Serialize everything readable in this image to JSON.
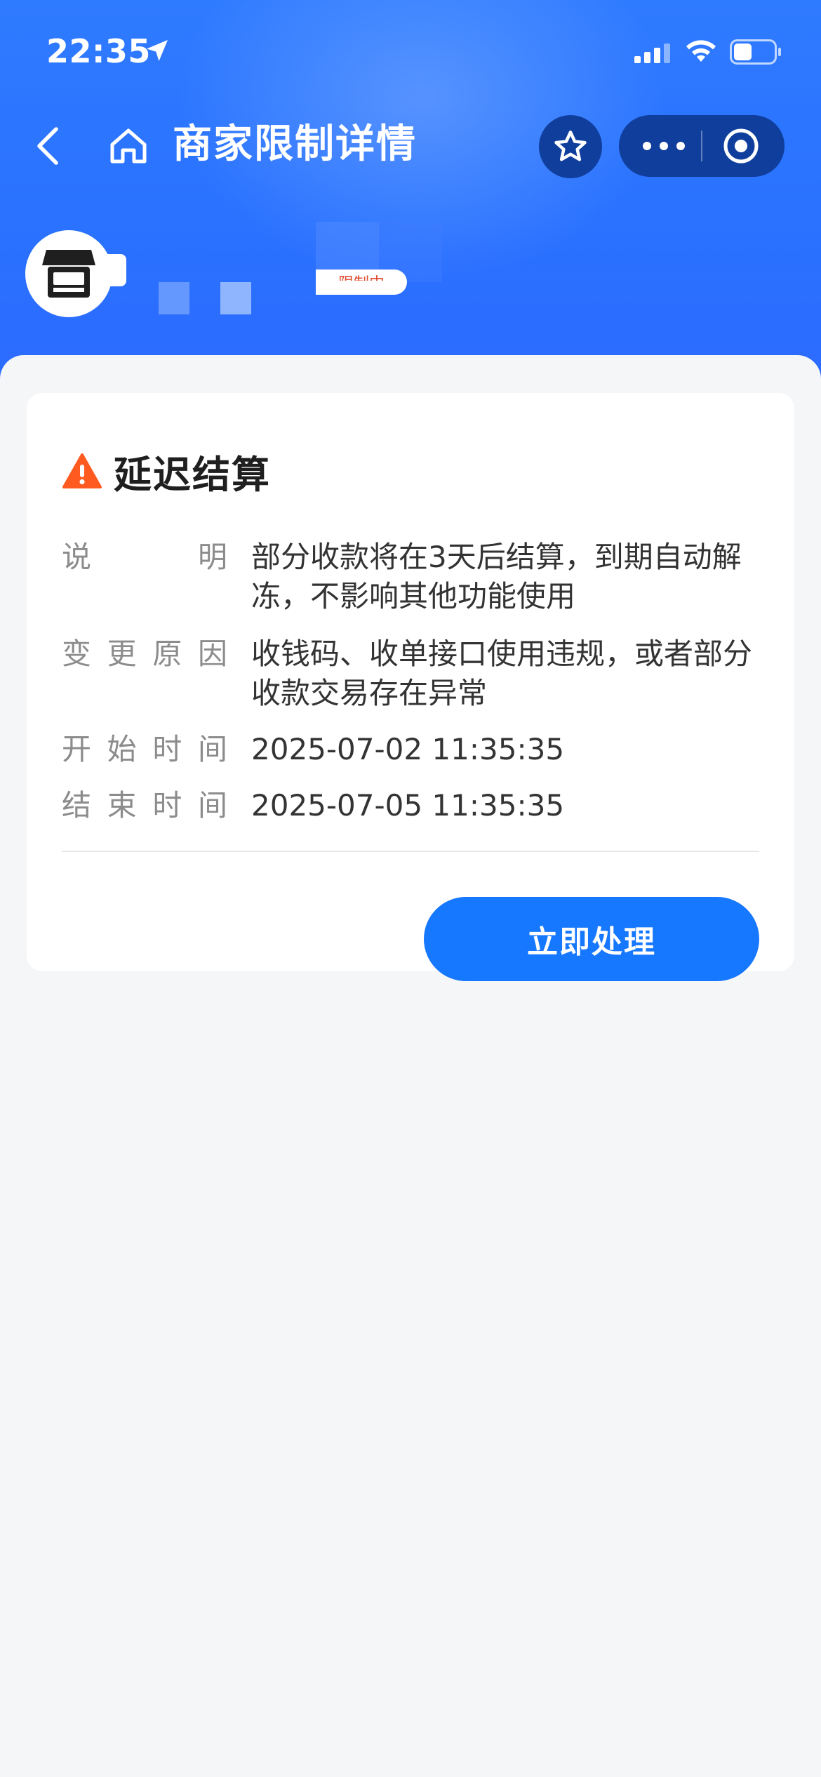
{
  "status_bar": {
    "time": "22:35",
    "location_icon": "location-arrow-icon",
    "signal_icon": "cellular-signal-icon",
    "wifi_icon": "wifi-icon",
    "battery_icon": "battery-icon",
    "battery_level": 0.45
  },
  "nav": {
    "back_icon": "chevron-left-icon",
    "home_icon": "home-icon",
    "title": "商家限制详情",
    "star_icon": "star-icon",
    "more_icon": "more-dots-icon",
    "target_icon": "target-icon"
  },
  "merchant": {
    "avatar_icon": "store-icon",
    "tag": "限制中"
  },
  "card": {
    "warning_icon": "warning-triangle-icon",
    "title": "延迟结算",
    "rows": [
      {
        "label": "说明",
        "value": "部分收款将在3天后结算，到期自动解冻，不影响其他功能使用"
      },
      {
        "label": "变更原因",
        "value": "收钱码、收单接口使用违规，或者部分收款交易存在异常"
      },
      {
        "label": "开始时间",
        "value": "2025-07-02 11:35:35"
      },
      {
        "label": "结束时间",
        "value": "2025-07-05 11:35:35"
      }
    ],
    "action_label": "立即处理"
  },
  "colors": {
    "header_blue": "#2f7bff",
    "capsule_dark": "#0f3e9c",
    "primary_button": "#1677ff",
    "warning_orange": "#ff5a1f",
    "page_bg": "#f5f6f8"
  }
}
